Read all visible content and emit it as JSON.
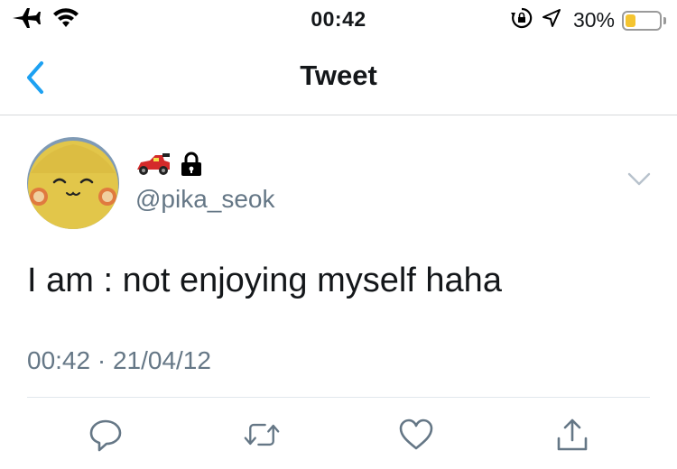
{
  "status_bar": {
    "time": "00:42",
    "battery_percent": "30%",
    "battery_level": 0.3,
    "left_icons": [
      "airplane-icon",
      "wifi-icon"
    ],
    "right_icons": [
      "orientation-lock-icon",
      "location-arrow-icon",
      "battery-icon"
    ]
  },
  "nav": {
    "title": "Tweet",
    "back_icon": "chevron-left-icon"
  },
  "tweet": {
    "display_name_icons": [
      "race-car-emoji",
      "lock-icon"
    ],
    "username": "@pika_seok",
    "text": "I am : not enjoying myself haha",
    "timestamp": "00:42 · 21/04/12",
    "menu_icon": "chevron-down-icon"
  },
  "actions": [
    "reply-icon",
    "retweet-icon",
    "like-icon",
    "share-icon"
  ],
  "colors": {
    "accent": "#1da1f2",
    "secondary_text": "#657786",
    "battery_fill": "#f4c430",
    "action_icon": "#657786"
  }
}
